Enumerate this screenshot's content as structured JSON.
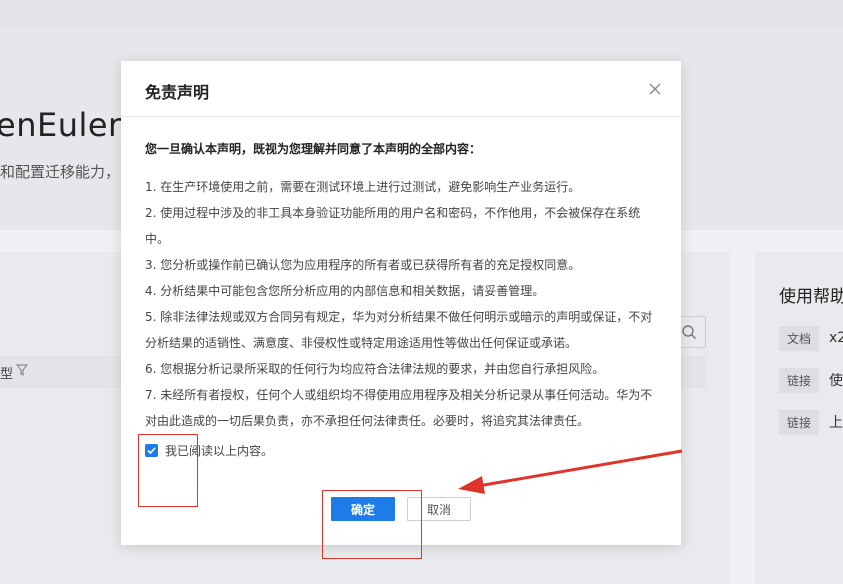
{
  "background": {
    "title": "enEuler !",
    "subtitle": "和配置迁移能力，",
    "table_header_label": "型",
    "help": {
      "title": "使用帮助",
      "rows": [
        {
          "tag": "文档",
          "text": "x2"
        },
        {
          "tag": "链接",
          "text": "使"
        },
        {
          "tag": "链接",
          "text": "上"
        }
      ]
    }
  },
  "modal": {
    "title": "免责声明",
    "intro": "您一旦确认本声明，既视为您理解并同意了本声明的全部内容：",
    "clauses": [
      "1. 在生产环境使用之前，需要在测试环境上进行过测试，避免影响生产业务运行。",
      "2. 使用过程中涉及的非工具本身验证功能所用的用户名和密码，不作他用，不会被保存在系统中。",
      "3. 您分析或操作前已确认您为应用程序的所有者或已获得所有者的充足授权同意。",
      "4. 分析结果中可能包含您所分析应用的内部信息和相关数据，请妥善管理。",
      "5. 除非法律法规或双方合同另有规定，华为对分析结果不做任何明示或暗示的声明或保证，不对分析结果的适销性、满意度、非侵权性或特定用途适用性等做出任何保证或承诺。",
      "6. 您根据分析记录所采取的任何行为均应符合法律法规的要求，并由您自行承担风险。",
      "7. 未经所有者授权，任何个人或组织均不得使用应用程序及相关分析记录从事任何活动。华为不对由此造成的一切后果负责，亦不承担任何法律责任。必要时，将追究其法律责任。"
    ],
    "agree_label": "我已阅读以上内容。",
    "agree_checked": true,
    "ok_label": "确定",
    "cancel_label": "取消"
  },
  "colors": {
    "primary": "#1e7ce8",
    "annotation": "#e0342b"
  }
}
